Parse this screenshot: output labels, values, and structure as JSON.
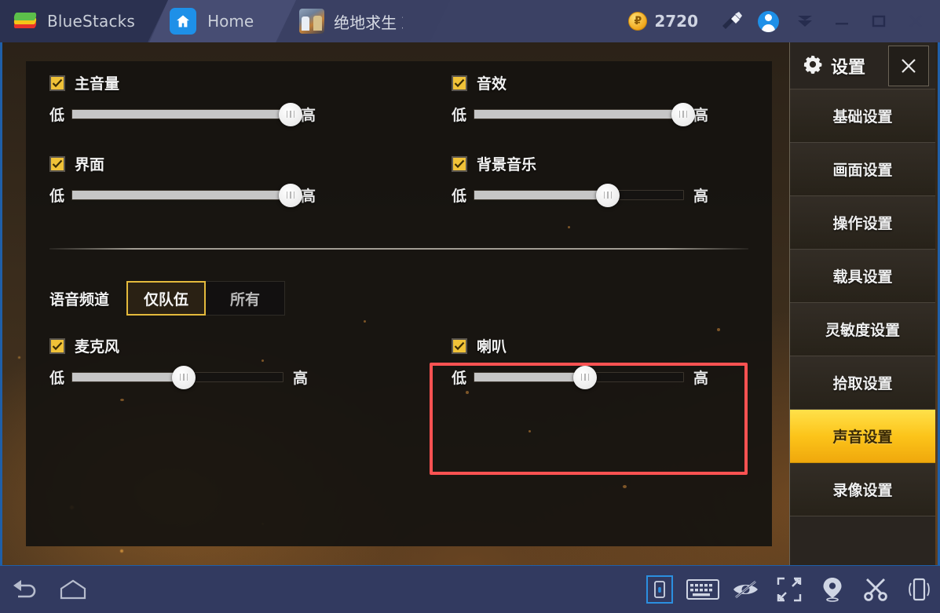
{
  "titlebar": {
    "brand": "BlueStacks",
    "brand_icon": "bluestacks-logo",
    "tabs": [
      {
        "label": "Home",
        "icon": "home-icon"
      },
      {
        "label": "绝地求生 刺激",
        "icon": "game-icon"
      }
    ],
    "currency": {
      "icon": "coin-icon",
      "symbol": "₽",
      "value": "2720"
    },
    "actions": [
      {
        "name": "paintbrush-icon"
      },
      {
        "name": "user-avatar-icon"
      }
    ],
    "window_controls": [
      {
        "name": "collapse-icon",
        "glyph": "▼"
      },
      {
        "name": "minimize-icon",
        "glyph": "—"
      },
      {
        "name": "maximize-icon",
        "glyph": "□"
      },
      {
        "name": "close-icon",
        "glyph": "✕"
      }
    ]
  },
  "settings_panel": {
    "header": {
      "title": "设置",
      "gear_icon": "gear-icon",
      "close_icon": "close-icon"
    },
    "menu": [
      {
        "label": "基础设置",
        "active": false
      },
      {
        "label": "画面设置",
        "active": false
      },
      {
        "label": "操作设置",
        "active": false
      },
      {
        "label": "载具设置",
        "active": false
      },
      {
        "label": "灵敏度设置",
        "active": false
      },
      {
        "label": "拾取设置",
        "active": false
      },
      {
        "label": "声音设置",
        "active": true
      },
      {
        "label": "录像设置",
        "active": false
      }
    ],
    "accent_color": "#fcc41a"
  },
  "sound_settings": {
    "slider_low_label": "低",
    "slider_high_label": "高",
    "volume_controls": [
      {
        "label": "主音量",
        "checked": true,
        "value": 100,
        "column": "left"
      },
      {
        "label": "音效",
        "checked": true,
        "value": 100,
        "column": "right"
      },
      {
        "label": "界面",
        "checked": true,
        "value": 100,
        "column": "left"
      },
      {
        "label": "背景音乐",
        "checked": true,
        "value": 64,
        "column": "right"
      },
      {
        "label": "麦克风",
        "checked": true,
        "value": 53,
        "column": "left"
      },
      {
        "label": "喇叭",
        "checked": true,
        "value": 53,
        "column": "right",
        "highlighted": true
      }
    ],
    "voice_channel": {
      "label": "语音频道",
      "options": [
        {
          "label": "仅队伍",
          "selected": true
        },
        {
          "label": "所有",
          "selected": false
        }
      ]
    },
    "highlight_color": "#fb5252"
  },
  "bottom_toolbar": {
    "left_icons": [
      {
        "name": "back-icon"
      },
      {
        "name": "home-outline-icon"
      }
    ],
    "right_icons": [
      {
        "name": "phone-lock-icon",
        "active": true
      },
      {
        "name": "keyboard-icon"
      },
      {
        "name": "eye-off-icon"
      },
      {
        "name": "fullscreen-icon"
      },
      {
        "name": "location-pin-icon"
      },
      {
        "name": "scissors-icon"
      },
      {
        "name": "shake-device-icon"
      }
    ]
  }
}
